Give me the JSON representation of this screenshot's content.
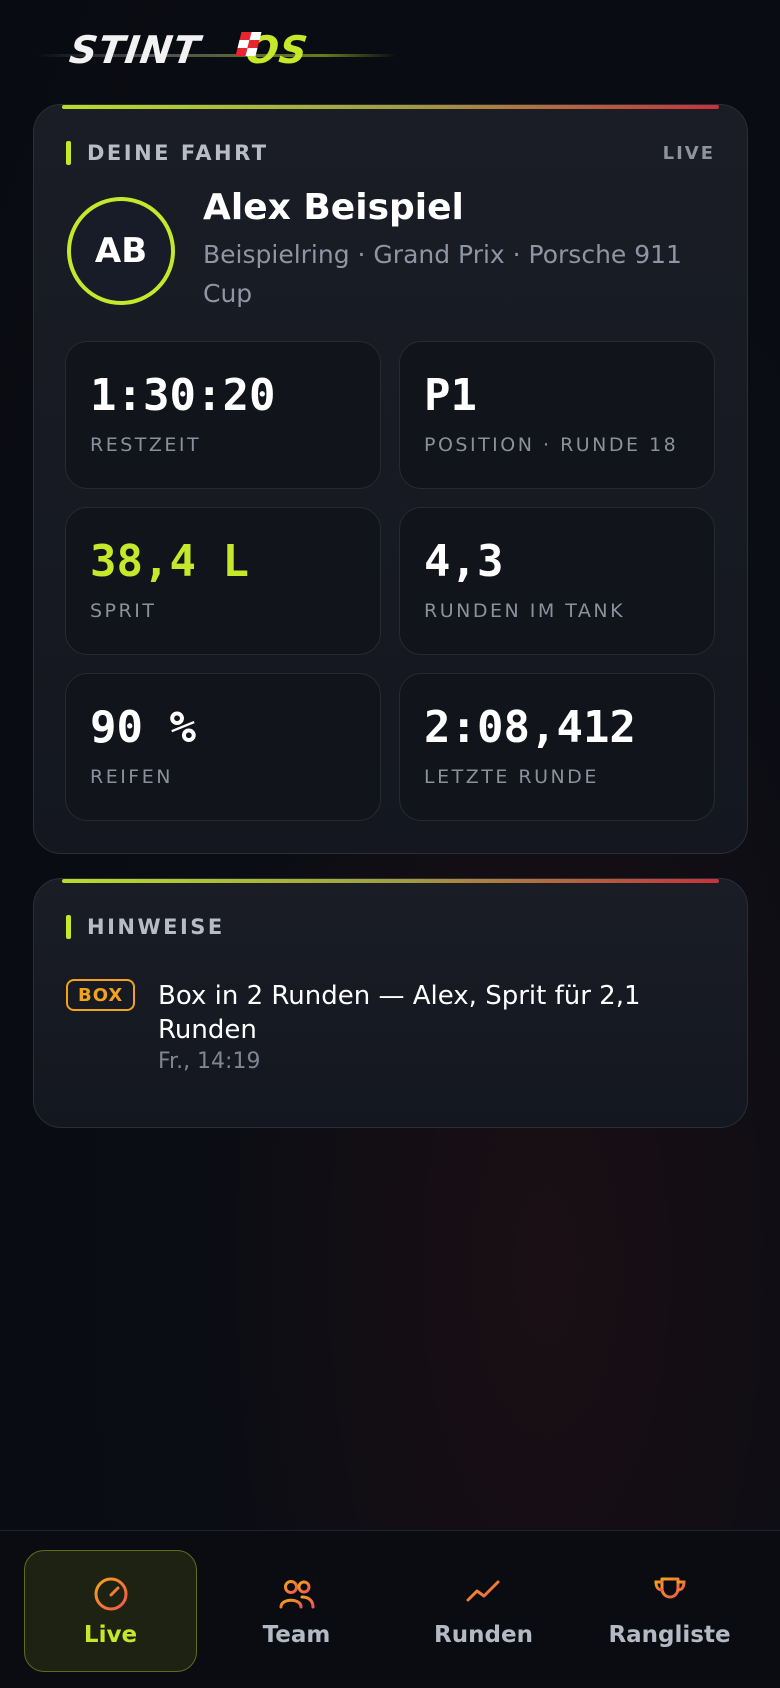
{
  "brand": {
    "name_main": "STINT",
    "name_accent": "OS",
    "accent_color": "#c6e82a"
  },
  "fahrt": {
    "section_label": "DEINE FAHRT",
    "live_label": "LIVE",
    "avatar_initials": "AB",
    "driver_name": "Alex Beispiel",
    "driver_subtitle": "Beispielring · Grand Prix · Porsche 911 Cup",
    "tiles": [
      {
        "value": "1:30:20",
        "label": "RESTZEIT"
      },
      {
        "value": "P1",
        "label": "POSITION · RUNDE 18"
      },
      {
        "value": "38,4 L",
        "label": "SPRIT"
      },
      {
        "value": "4,3",
        "label": "RUNDEN IM TANK"
      },
      {
        "value": "90 %",
        "label": "REIFEN"
      },
      {
        "value": "2:08,412",
        "label": "LETZTE RUNDE"
      }
    ]
  },
  "hinweise": {
    "section_label": "HINWEISE",
    "items": [
      {
        "badge": "BOX",
        "text": "Box in 2 Runden — Alex, Sprit für 2,1 Runden",
        "time": "Fr., 14:19"
      }
    ]
  },
  "nav": {
    "items": [
      {
        "label": "Live",
        "icon": "gauge-icon",
        "active": true
      },
      {
        "label": "Team",
        "icon": "users-icon",
        "active": false
      },
      {
        "label": "Runden",
        "icon": "chart-line-icon",
        "active": false
      },
      {
        "label": "Rangliste",
        "icon": "trophy-icon",
        "active": false
      }
    ]
  },
  "colors": {
    "accent": "#c6e82a",
    "warning": "#f2a31c",
    "nav_icon": "#f2784b"
  }
}
